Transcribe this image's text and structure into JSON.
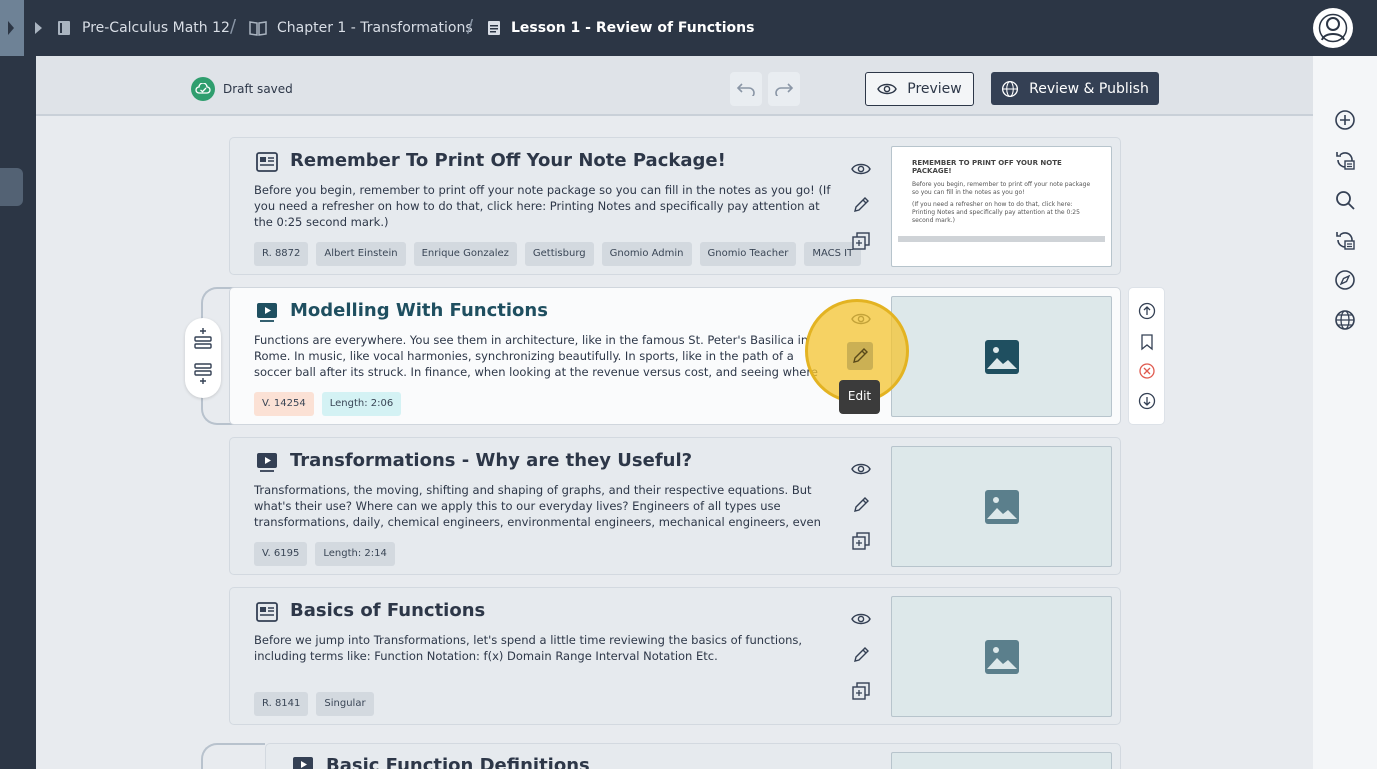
{
  "breadcrumb": {
    "course": "Pre-Calculus Math 12",
    "chapter": "Chapter 1 - Transformations",
    "lesson": "Lesson 1 - Review of Functions",
    "separator": "/"
  },
  "toolbar": {
    "draft_status": "Draft saved",
    "preview_label": "Preview",
    "publish_label": "Review & Publish"
  },
  "cards": [
    {
      "type": "note",
      "title": "Remember To Print Off Your Note Package!",
      "description": "Before you begin, remember to print off your note package so you can fill in the notes as you go! (If you need a refresher on how to do that, click here: Printing Notes and specifically pay attention at the 0:25 second mark.)",
      "tags": [
        "R. 8872",
        "Albert Einstein",
        "Enrique Gonzalez",
        "Gettisburg",
        "Gnomio Admin",
        "Gnomio Teacher",
        "MACS IT"
      ],
      "thumb": {
        "title": "REMEMBER TO PRINT OFF YOUR NOTE PACKAGE!",
        "line1": "Before you begin, remember to print off your note package so you can fill in the notes as you go!",
        "line2": "(If you need a refresher on how to do that, click here: Printing Notes and specifically pay attention at the 0:25 second mark.)"
      }
    },
    {
      "type": "video",
      "title": "Modelling With Functions",
      "description": "Functions are everywhere. You see them in architecture, like in the famous St. Peter's Basilica in Rome. In music, like vocal harmonies, synchronizing beautifully. In sports, like in the path of a soccer ball after its struck. In finance, when looking at the revenue versus cost, and seeing where that sweet spot of...",
      "tags": [
        "V. 14254",
        "Length: 2:06"
      ]
    },
    {
      "type": "video",
      "title": "Transformations - Why are they Useful?",
      "description": "Transformations, the moving, shifting and shaping of graphs, and their respective equations. But what's their use? Where can we apply this to our everyday lives? Engineers of all types use transformations, daily, chemical engineers, environmental engineers, mechanical engineers, even aerospace engineers....",
      "tags": [
        "V. 6195",
        "Length: 2:14"
      ]
    },
    {
      "type": "note",
      "title": "Basics of Functions",
      "description": "Before we jump into Transformations, let's spend a little time reviewing the basics of functions, including terms like: Function Notation: f(x) Domain Range Interval Notation Etc.",
      "tags": [
        "R. 8141",
        "Singular"
      ]
    },
    {
      "type": "video",
      "title": "Basic Function Definitions"
    }
  ],
  "tooltip": "Edit",
  "icons": {
    "right_rail": [
      "plus-circle-icon",
      "history-icon",
      "search-icon",
      "history-list-icon",
      "compass-icon",
      "globe-icon"
    ],
    "card_actions": [
      "eye-icon",
      "pencil-icon",
      "duplicate-icon"
    ],
    "side_panel": [
      "arrow-up-circle-icon",
      "bookmark-icon",
      "close-circle-icon",
      "arrow-down-circle-icon"
    ]
  },
  "colors": {
    "topbar": "#2c3645",
    "publish_button": "#344054",
    "highlight": "#f4c430",
    "draft_saved": "#2f9e6e",
    "delete": "#e05a4f"
  }
}
